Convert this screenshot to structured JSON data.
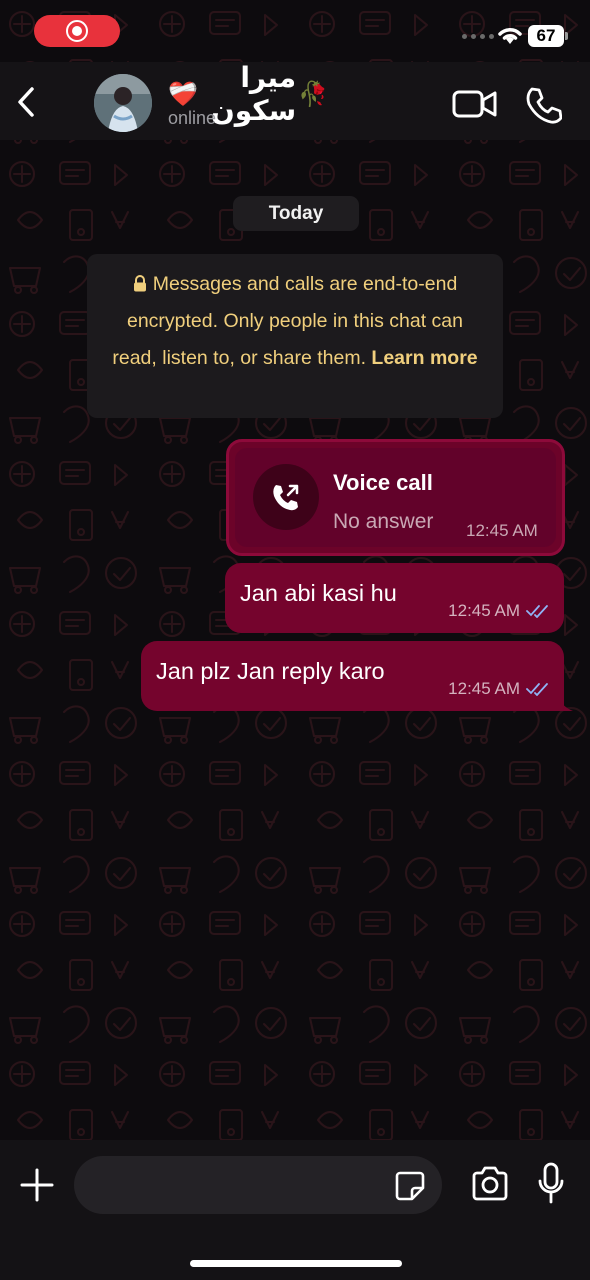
{
  "status_bar": {
    "battery_level": "67",
    "recording_active": true
  },
  "header": {
    "contact_name": "میرا سکون",
    "contact_name_decor_left": "❤️‍🩹",
    "contact_name_decor_right": "🥀",
    "contact_status": "online",
    "icons": [
      "back-icon",
      "video-call-icon",
      "voice-call-icon"
    ]
  },
  "chat": {
    "date_separator": "Today",
    "encryption_notice": {
      "text": "Messages and calls are end-to-end encrypted. Only people in this chat can read, listen to, or share them.",
      "link": "Learn more"
    },
    "messages": [
      {
        "type": "call",
        "title": "Voice call",
        "subtitle": "No answer",
        "time": "12:45 AM"
      },
      {
        "type": "text",
        "text": "Jan abi kasi hu",
        "time": "12:45 AM",
        "status": "read"
      },
      {
        "type": "text",
        "text": "Jan plz Jan reply karo",
        "time": "12:45 AM",
        "status": "read"
      }
    ]
  },
  "composer": {
    "placeholder": "",
    "icons": [
      "plus-icon",
      "sticker-icon",
      "camera-icon",
      "microphone-icon"
    ]
  },
  "colors": {
    "bubble_outgoing": "#75042d",
    "encryption_text": "#f0cf7d",
    "read_ticks": "#8fb4f5",
    "header_bg": "#151316"
  }
}
